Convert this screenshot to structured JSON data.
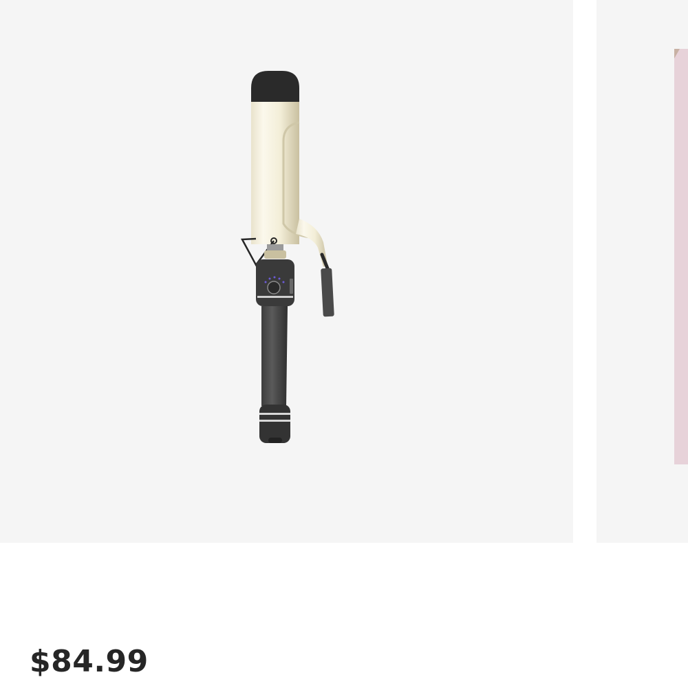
{
  "product_card": {
    "image_icon": "curling-iron-product-image",
    "price": "$84.99"
  },
  "next_card": {
    "image_icon": "product-image-partial"
  },
  "colors": {
    "card_background": "#f5f5f5",
    "page_background": "#ffffff",
    "price_text": "#262626",
    "next_card_accent": "#e7d2d9"
  }
}
